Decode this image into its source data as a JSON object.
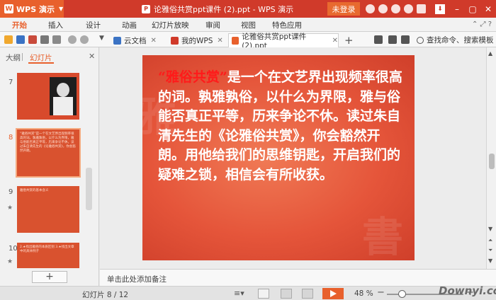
{
  "titlebar": {
    "app_name": "WPS 演示",
    "doc_title": "论雅俗共赏ppt课件 (2).ppt - WPS 演示",
    "login": "未登录"
  },
  "ribbon": {
    "tabs": [
      "开始",
      "插入",
      "设计",
      "动画",
      "幻灯片放映",
      "审阅",
      "视图",
      "特色应用"
    ]
  },
  "doc_tabs": {
    "tab1": "云文档",
    "tab2": "我的WPS",
    "tab3": "论雅俗共赏ppt课件 (2).ppt",
    "search": "查找命令、搜索模板"
  },
  "left_panel": {
    "tab_outline": "大纲",
    "tab_slides": "幻灯片",
    "thumbs": [
      {
        "num": "7"
      },
      {
        "num": "8",
        "text": "“雅俗共赏”是一个在文艺界出现频率很高的词。孰雅孰俗，以什么为界限，雅与俗能否真正平等，历来争论不休。读过朱自清先生的《论雅俗共赏》，你会豁然开朗。"
      },
      {
        "num": "9",
        "text": "雅俗共赏的基本含义"
      },
      {
        "num": "10",
        "text": "2.★找出雅俗的本质区别 3.★找出文章中的具体例子"
      }
    ]
  },
  "slide": {
    "highlight": "“雅俗共赏”",
    "body": "是一个在文艺界出现频率很高的词。孰雅孰俗，以什么为界限，雅与俗能否真正平等，历来争论不休。读过朱自清先生的《论雅俗共赏》，你会豁然开朗。用他给我们的思维钥匙，开启我们的疑难之锁，相信会有所收获。"
  },
  "notes": {
    "placeholder": "单击此处添加备注"
  },
  "status": {
    "slide_info": "幻灯片 8 / 12",
    "zoom": "48 %"
  },
  "watermark": "Downyi.com",
  "colors": {
    "accent": "#e8602c",
    "titlebar": "#d03a2a",
    "slide_red": "#e5553a",
    "highlight_red": "#ff1a1a"
  }
}
